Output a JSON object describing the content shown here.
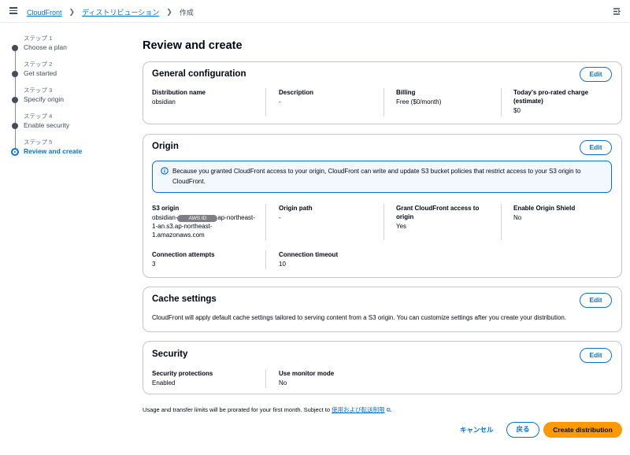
{
  "header": {
    "breadcrumbs": [
      "CloudFront",
      "ディストリビューション",
      "作成"
    ]
  },
  "steps": [
    {
      "num": "ステップ 1",
      "label": "Choose a plan"
    },
    {
      "num": "ステップ 2",
      "label": "Get started"
    },
    {
      "num": "ステップ 3",
      "label": "Specify origin"
    },
    {
      "num": "ステップ 4",
      "label": "Enable security"
    },
    {
      "num": "ステップ 5",
      "label": "Review and create"
    }
  ],
  "page_title": "Review and create",
  "general": {
    "title": "General configuration",
    "edit": "Edit",
    "fields": [
      {
        "k": "Distribution name",
        "v": "obsidian"
      },
      {
        "k": "Description",
        "v": "-"
      },
      {
        "k": "Billing",
        "v": "Free ($0/month)"
      },
      {
        "k": "Today's pro-rated charge (estimate)",
        "v": "$0"
      }
    ]
  },
  "origin": {
    "title": "Origin",
    "edit": "Edit",
    "info": "Because you granted CloudFront access to your origin, CloudFront can write and update S3 bucket policies that restrict access to your S3 origin to CloudFront.",
    "s3_label": "S3 origin",
    "s3_prefix": "obsidian-",
    "s3_mask": "AWS ID",
    "s3_suffix": "ap-northeast-1-an.s3.ap-northeast-1.amazonaws.com",
    "path_label": "Origin path",
    "path_value": "-",
    "grant_label": "Grant CloudFront access to origin",
    "grant_value": "Yes",
    "shield_label": "Enable Origin Shield",
    "shield_value": "No",
    "attempts_label": "Connection attempts",
    "attempts_value": "3",
    "timeout_label": "Connection timeout",
    "timeout_value": "10"
  },
  "cache": {
    "title": "Cache settings",
    "edit": "Edit",
    "text": "CloudFront will apply default cache settings tailored to serving content from a S3 origin. You can customize settings after you create your distribution."
  },
  "security": {
    "title": "Security",
    "edit": "Edit",
    "prot_label": "Security protections",
    "prot_value": "Enabled",
    "monitor_label": "Use monitor mode",
    "monitor_value": "No"
  },
  "footnote": {
    "text": "Usage and transfer limits will be prorated for your first month. Subject to",
    "link": "使用および転送制限"
  },
  "actions": {
    "cancel": "キャンセル",
    "back": "戻る",
    "create": "Create distribution"
  }
}
